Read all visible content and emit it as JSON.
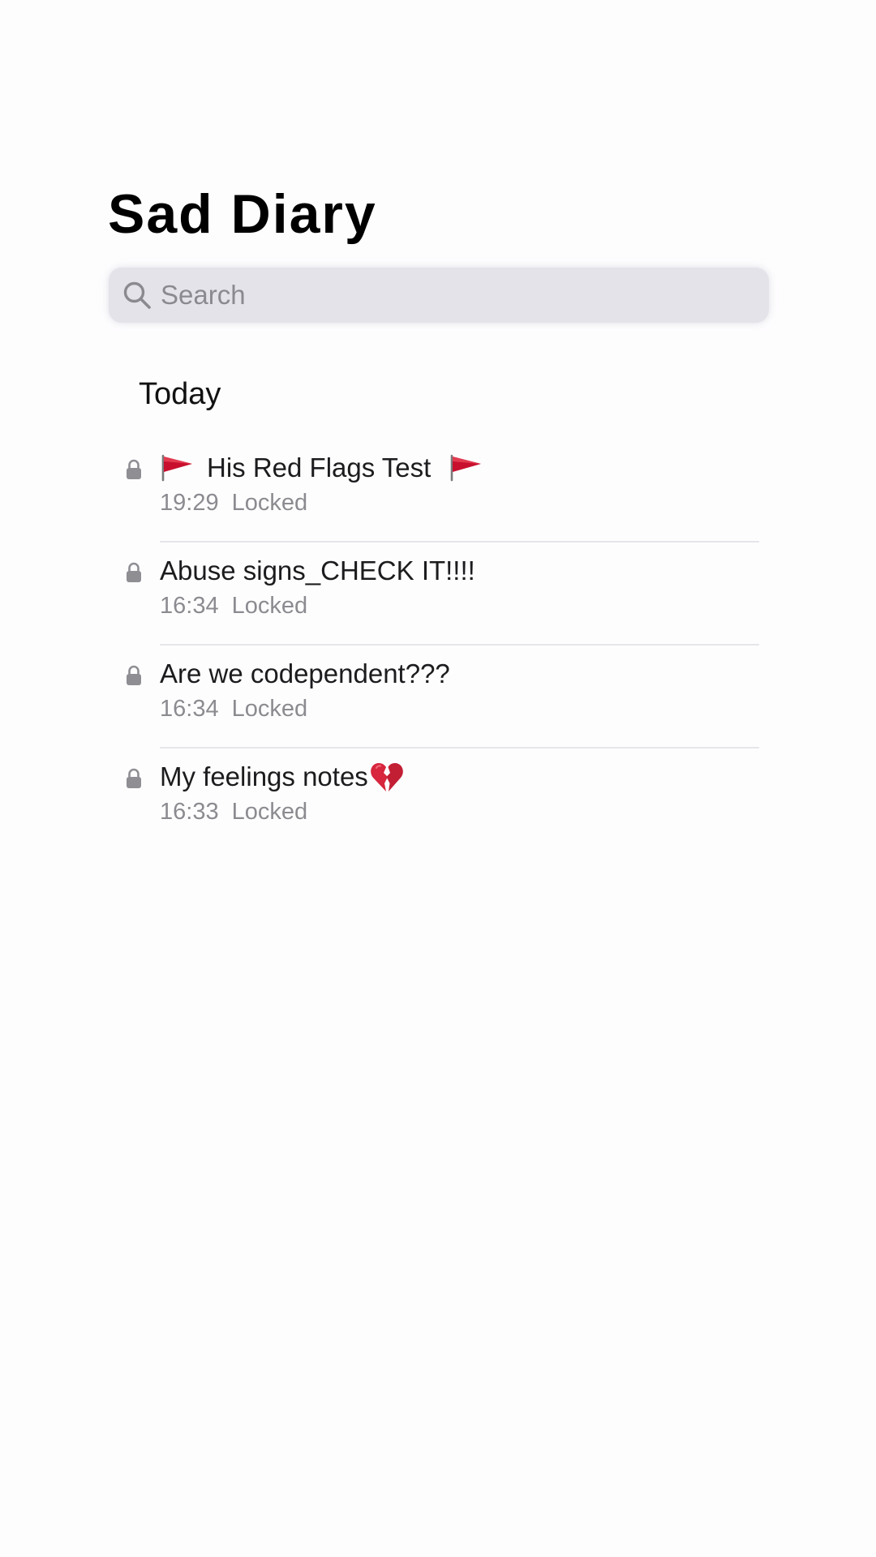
{
  "app": {
    "title": "Sad Diary"
  },
  "search": {
    "placeholder": "Search",
    "value": "",
    "icon": "search-icon"
  },
  "section": {
    "header": "Today"
  },
  "notes": [
    {
      "title": "His Red Flags Test",
      "lead_icon": "red-flag-icon",
      "trail_icon": "red-flag-icon",
      "time": "19:29",
      "status": "Locked",
      "locked": true
    },
    {
      "title": "Abuse signs_CHECK IT!!!!",
      "time": "16:34",
      "status": "Locked",
      "locked": true
    },
    {
      "title": "Are we codependent???",
      "time": "16:34",
      "status": "Locked",
      "locked": true
    },
    {
      "title": "My feelings notes",
      "trail_icon": "broken-heart-icon",
      "time": "16:33",
      "status": "Locked",
      "locked": true
    }
  ],
  "colors": {
    "background": "#fefdfe",
    "search_bar": "#e4e3ea",
    "secondary_text": "#8b8b90",
    "flag_red": "#c8102e",
    "divider": "#e5e5ea"
  }
}
